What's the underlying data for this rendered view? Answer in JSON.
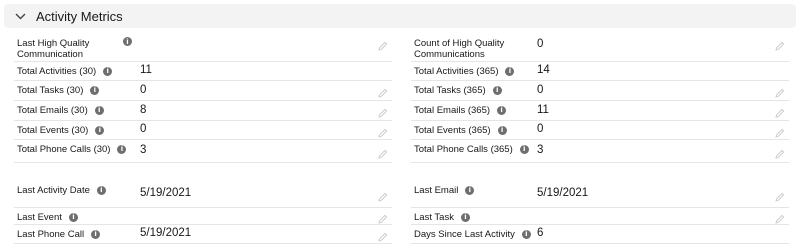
{
  "section": {
    "title": "Activity Metrics"
  },
  "icons": {
    "collapse": "chevron-down-icon",
    "info": "info-icon",
    "edit": "pencil-icon"
  },
  "colors": {
    "header_bg": "#f3f3f3",
    "info_icon": "#706e6b",
    "divider": "#e5e5e5",
    "pencil": "#c9c7c5"
  },
  "left_fields": [
    {
      "label": "Last High Quality Communication",
      "value": "",
      "editable": true
    },
    {
      "label": "Total Activities (30)",
      "value": "11",
      "editable": false
    },
    {
      "label": "Total Tasks (30)",
      "value": "0",
      "editable": true
    },
    {
      "label": "Total Emails (30)",
      "value": "8",
      "editable": true
    },
    {
      "label": "Total Events (30)",
      "value": "0",
      "editable": true
    },
    {
      "label": "Total Phone Calls (30)",
      "value": "3",
      "editable": true
    },
    {
      "label": "Last Activity Date",
      "value": "5/19/2021",
      "editable": true
    },
    {
      "label": "Last Event",
      "value": "",
      "editable": true
    },
    {
      "label": "Last Phone Call",
      "value": "5/19/2021",
      "editable": true
    }
  ],
  "right_fields": [
    {
      "label": "Count of High Quality Communications",
      "value": "0",
      "editable": true
    },
    {
      "label": "Total Activities (365)",
      "value": "14",
      "editable": false
    },
    {
      "label": "Total Tasks (365)",
      "value": "0",
      "editable": true
    },
    {
      "label": "Total Emails (365)",
      "value": "11",
      "editable": true
    },
    {
      "label": "Total Events (365)",
      "value": "0",
      "editable": true
    },
    {
      "label": "Total Phone Calls (365)",
      "value": "3",
      "editable": true
    },
    {
      "label": "Last Email",
      "value": "5/19/2021",
      "editable": true
    },
    {
      "label": "Last Task",
      "value": "",
      "editable": true
    },
    {
      "label": "Days Since Last Activity",
      "value": "6",
      "editable": false
    }
  ]
}
